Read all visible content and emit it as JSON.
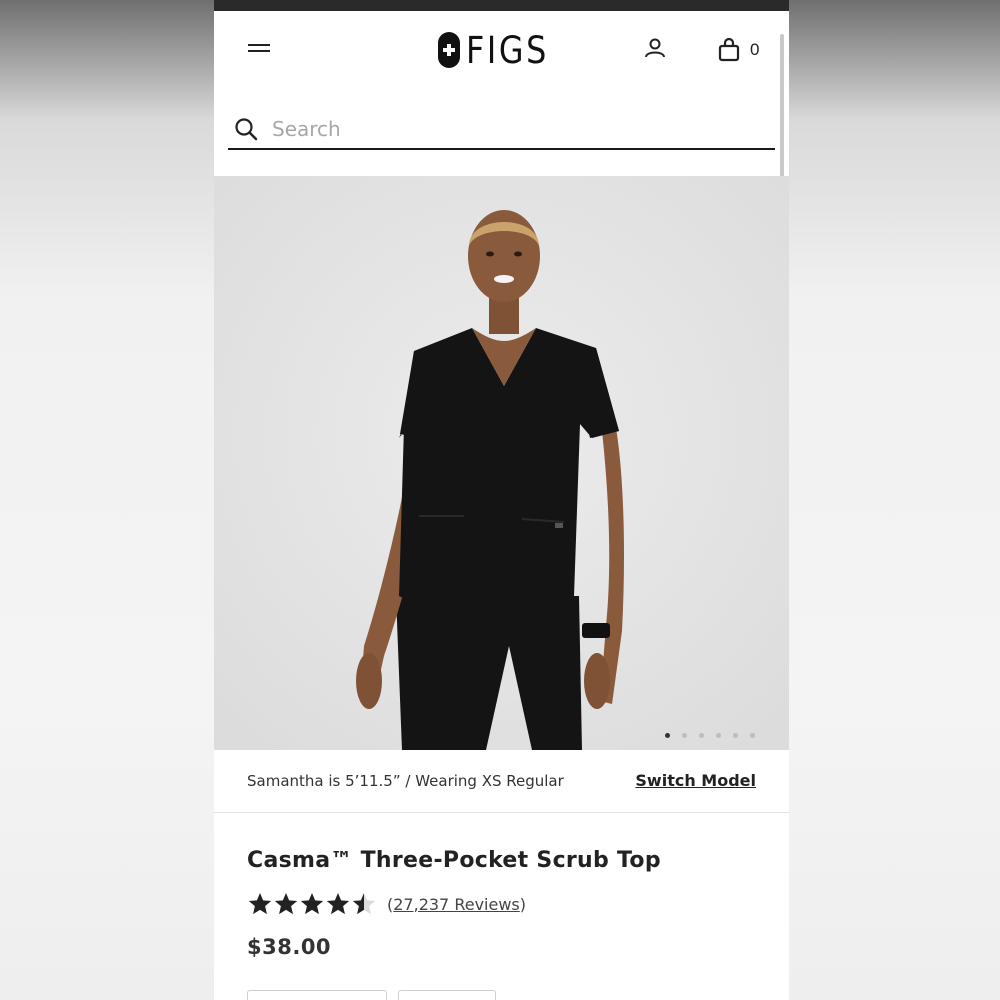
{
  "header": {
    "brand": "FIGS",
    "cart_count": "0"
  },
  "search": {
    "placeholder": "Search"
  },
  "gallery": {
    "slide_count": 6,
    "active_slide": 1
  },
  "model_bar": {
    "info": "Samantha is 5’11.5” / Wearing XS Regular",
    "switch_label": "Switch Model"
  },
  "product": {
    "title": "Casma™ Three-Pocket Scrub Top",
    "rating": 4.5,
    "reviews_open": "(",
    "reviews_link": "27,237 Reviews",
    "reviews_close": ")",
    "price": "$38.00"
  },
  "colors": {
    "text": "#222222",
    "hero_bg": "#e5e5e5",
    "scrub": "#141414"
  },
  "icons": [
    "menu-icon",
    "figs-logo-icon",
    "account-icon",
    "bag-icon",
    "search-icon",
    "star-icon"
  ]
}
